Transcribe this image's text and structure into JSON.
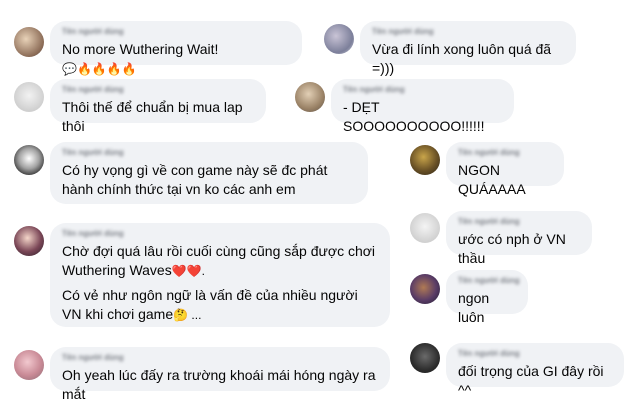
{
  "comments": [
    {
      "id": "c1",
      "name": "Tên người dùng",
      "text": "No more Wuthering Wait!",
      "emoji": "💬🔥🔥🔥🔥"
    },
    {
      "id": "c2",
      "name": "Tên người dùng",
      "text": "Vừa đi lính xong luôn quá đã =)))"
    },
    {
      "id": "c3",
      "name": "Tên người dùng",
      "text": "Thôi thế để chuẩn bị mua lap thôi"
    },
    {
      "id": "c4",
      "name": "Tên người dùng",
      "text": "- DẸT SOOOOOOOOOO!!!!!!"
    },
    {
      "id": "c5",
      "name": "Tên người dùng",
      "text": "Có hy vọng gì về con game này sẽ đc phát hành chính thức tại vn ko các anh em"
    },
    {
      "id": "c6",
      "name": "Tên người dùng",
      "text": "NGON QUÁAAAA"
    },
    {
      "id": "c7",
      "name": "Tên người dùng",
      "text": "Chờ đợi quá lâu rồi cuối cùng cũng sắp được chơi Wuthering Waves",
      "emoji": "❤️❤️.",
      "text2": "Có vẻ như ngôn ngữ là vấn đề của nhiều người VN khi chơi game",
      "emoji2": "🤔 ..."
    },
    {
      "id": "c8",
      "name": "Tên người dùng",
      "text": "ước có nph ở VN thầu"
    },
    {
      "id": "c9",
      "name": "Tên người dùng",
      "text": "ngon luôn"
    },
    {
      "id": "c10",
      "name": "Tên người dùng",
      "text": "Oh yeah lúc đấy ra trường khoái mái hóng ngày ra mắt"
    },
    {
      "id": "c11",
      "name": "Tên người dùng",
      "text": "đối trọng của GI đây rồi ^^"
    }
  ],
  "colors": {
    "bubble": "#f0f2f5",
    "text": "#050505",
    "name": "#7b7f86"
  }
}
